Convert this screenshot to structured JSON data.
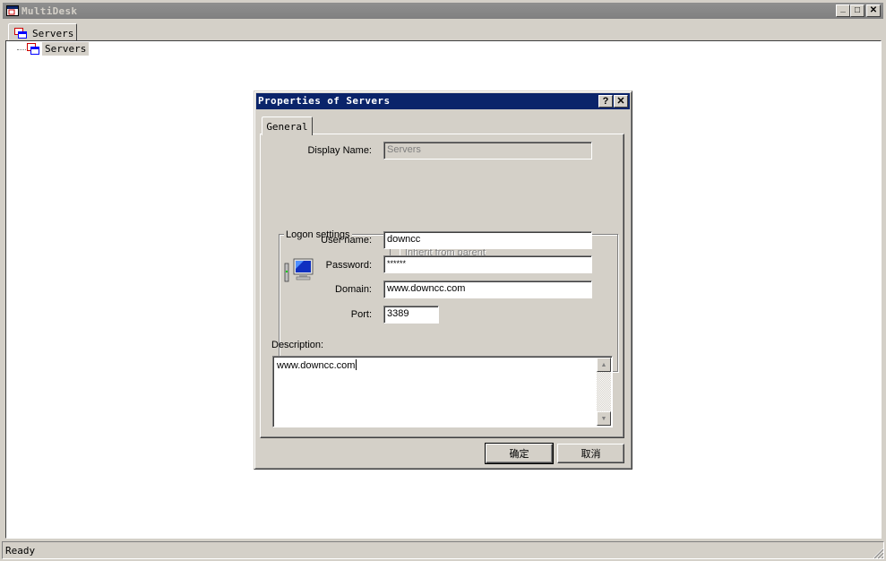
{
  "app": {
    "title": "MultiDesk",
    "icon": "multidesk-window-icon",
    "controls": {
      "minimize": "_",
      "maximize": "□",
      "close": "✕"
    }
  },
  "tabs": [
    {
      "label": "Servers",
      "icon": "servers-icon",
      "active": true
    }
  ],
  "tree": {
    "items": [
      {
        "label": "Servers",
        "icon": "servers-icon",
        "selected": true
      }
    ]
  },
  "status": {
    "text": "Ready"
  },
  "dialog": {
    "title": "Properties of Servers",
    "controls": {
      "help": "?",
      "close": "✕"
    },
    "tabs": [
      {
        "label": "General",
        "active": true
      }
    ],
    "display_name": {
      "label": "Display Name:",
      "value": "Servers",
      "disabled": true
    },
    "logon": {
      "legend": "Logon settings",
      "inherit_label": "Inherit from parent",
      "inherit_checked": false,
      "icon": "computer-network-icon",
      "username": {
        "label": "User name:",
        "value": "downcc"
      },
      "password": {
        "label": "Password:",
        "value": "******"
      },
      "domain": {
        "label": "Domain:",
        "value": "www.downcc.com"
      },
      "port": {
        "label": "Port:",
        "value": "3389"
      }
    },
    "description": {
      "label": "Description:",
      "value": "www.downcc.com"
    },
    "buttons": {
      "ok": "确定",
      "cancel": "取消"
    }
  },
  "colors": {
    "face": "#d4d0c8",
    "dialog_title_bg": "#0a246a",
    "inactive_title_bg": "#808080",
    "content_bg": "#ffffff"
  }
}
